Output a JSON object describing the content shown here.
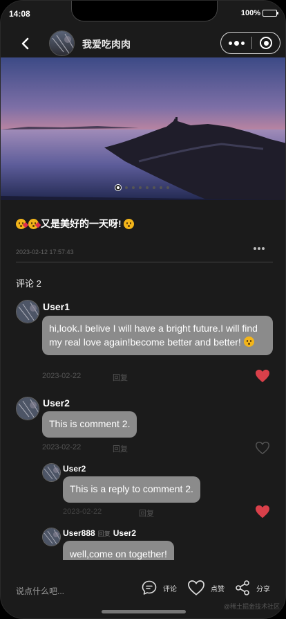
{
  "status_bar": {
    "time": "14:08",
    "battery": "100%"
  },
  "nav": {
    "title": "我爱吃肉肉"
  },
  "post": {
    "text": "又是美好的一天呀!",
    "time": "2023-02-12 17:57:43"
  },
  "comments_header": {
    "label": "评论 2"
  },
  "comments": [
    {
      "user": "User1",
      "text": "hi,look.I belive I will have a bright future.I will find my real love again!become better and better!",
      "date": "2023-02-22",
      "reply_label": "回复",
      "liked": true
    },
    {
      "user": "User2",
      "text": "This is comment 2.",
      "date": "2023-02-22",
      "reply_label": "回复",
      "liked": false
    }
  ],
  "replies": [
    {
      "user": "User2",
      "text": "This is a reply to comment 2.",
      "date": "2023-02-22",
      "reply_label": "回复",
      "liked": true
    },
    {
      "user": "User888",
      "reply_word": "回复",
      "reply_to": "User2",
      "text": "well,come on together!"
    }
  ],
  "bottom_bar": {
    "input_placeholder": "说点什么吧...",
    "comment_label": "评论",
    "like_label": "点赞",
    "share_label": "分享"
  },
  "watermark": "@稀土掘金技术社区",
  "colors": {
    "background": "#1b1b1b",
    "bubble": "#8b8b8b",
    "liked_heart": "#d9404a"
  },
  "banner": {
    "active_index": 0,
    "slide_count": 8
  }
}
